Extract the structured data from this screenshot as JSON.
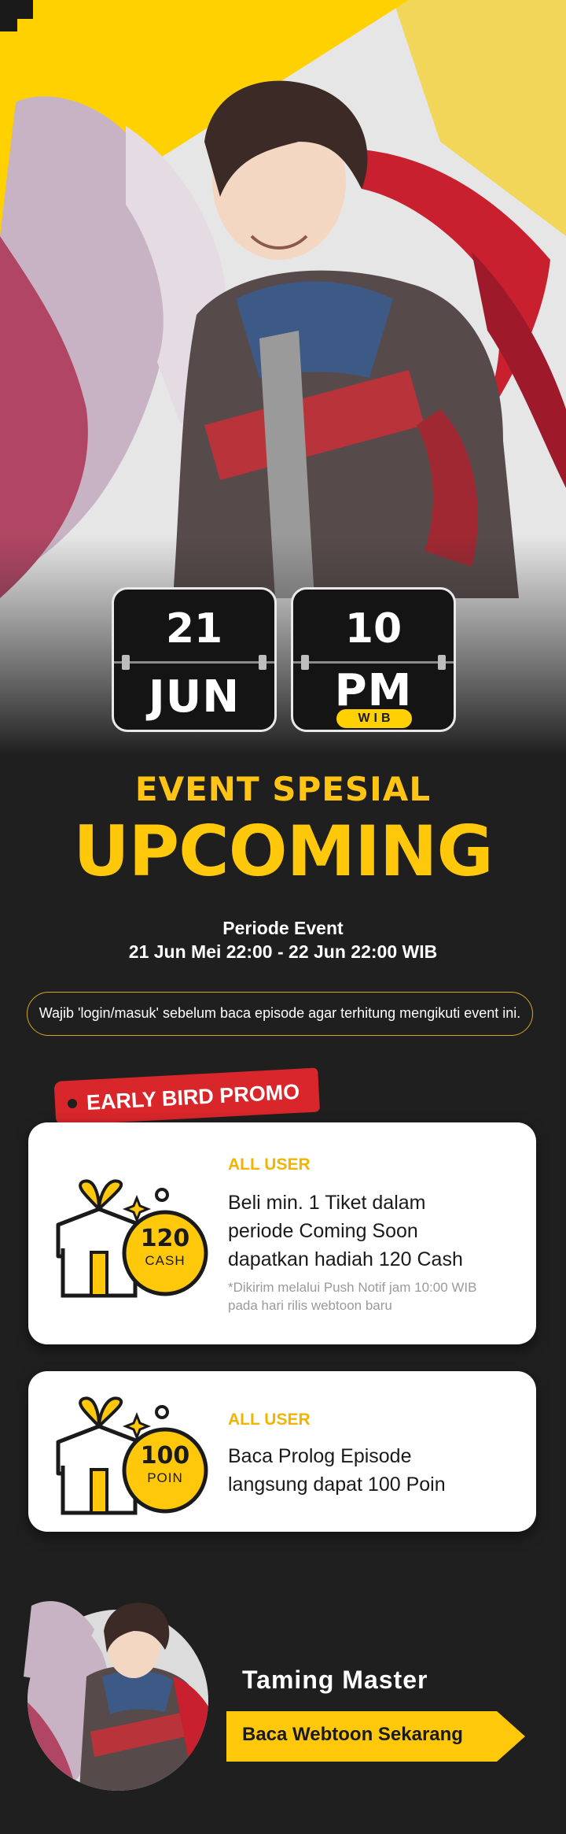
{
  "event": {
    "day": "21",
    "month": "JUN",
    "hour": "10",
    "ampm": "PM",
    "timezone": "WIB",
    "subtitle": "EVENT SPESIAL",
    "title": "UPCOMING",
    "periode_label": "Periode Event",
    "periode_value": "21 Jun Mei 22:00 - 22 Jun 22:00 WIB",
    "notice": "Wajib 'login/masuk' sebelum baca episode agar terhitung mengikuti event ini."
  },
  "promo": {
    "tag": "EARLY BIRD PROMO",
    "cards": [
      {
        "label": "ALL USER",
        "desc_lines": [
          "Beli min. 1 Tiket dalam",
          "periode Coming Soon",
          "dapatkan hadiah 120 Cash"
        ],
        "note_lines": [
          "*Dikirim melalui Push Notif jam 10:00 WIB",
          "pada hari rilis webtoon baru"
        ],
        "amount": "120",
        "unit": "CASH"
      },
      {
        "label": "ALL USER",
        "desc_lines": [
          "Baca Prolog Episode",
          "langsung dapat 100 Poin"
        ],
        "amount": "100",
        "unit": "POIN"
      }
    ]
  },
  "footer": {
    "title": "Taming Master",
    "cta": "Baca Webtoon Sekarang"
  },
  "colors": {
    "background": "#1f1f1f",
    "accent_yellow": "#ffc80a",
    "tag_red": "#d8262b",
    "card_bg": "#ffffff"
  },
  "icons": [
    "logo-icon",
    "gift-box-icon",
    "coin-icon",
    "sparkle-icon",
    "arrow-right-icon"
  ]
}
